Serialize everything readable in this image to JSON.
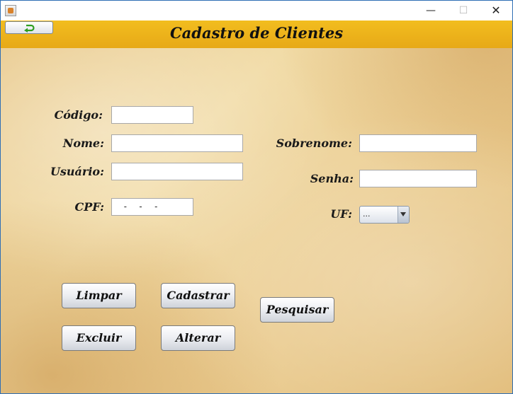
{
  "window": {
    "title": "",
    "controls": {
      "minimize": "—",
      "maximize": "☐",
      "close": "✕"
    },
    "app_icon": "java-cup-icon"
  },
  "header": {
    "title": "Cadastro de Clientes",
    "back_icon": "return-arrow-icon",
    "colors": {
      "header": "#f0b41c",
      "back_arrow": "#2e9e1f"
    }
  },
  "form": {
    "codigo": {
      "label": "Código:",
      "value": ""
    },
    "nome": {
      "label": "Nome:",
      "value": ""
    },
    "usuario": {
      "label": "Usuário:",
      "value": ""
    },
    "cpf": {
      "label": "CPF:",
      "value": " -  -  - "
    },
    "sobrenome": {
      "label": "Sobrenome:",
      "value": ""
    },
    "senha": {
      "label": "Senha:",
      "value": ""
    },
    "uf": {
      "label": "UF:",
      "selected": "..."
    }
  },
  "buttons": {
    "limpar": "Limpar",
    "cadastrar": "Cadastrar",
    "pesquisar": "Pesquisar",
    "excluir": "Excluir",
    "alterar": "Alterar"
  }
}
